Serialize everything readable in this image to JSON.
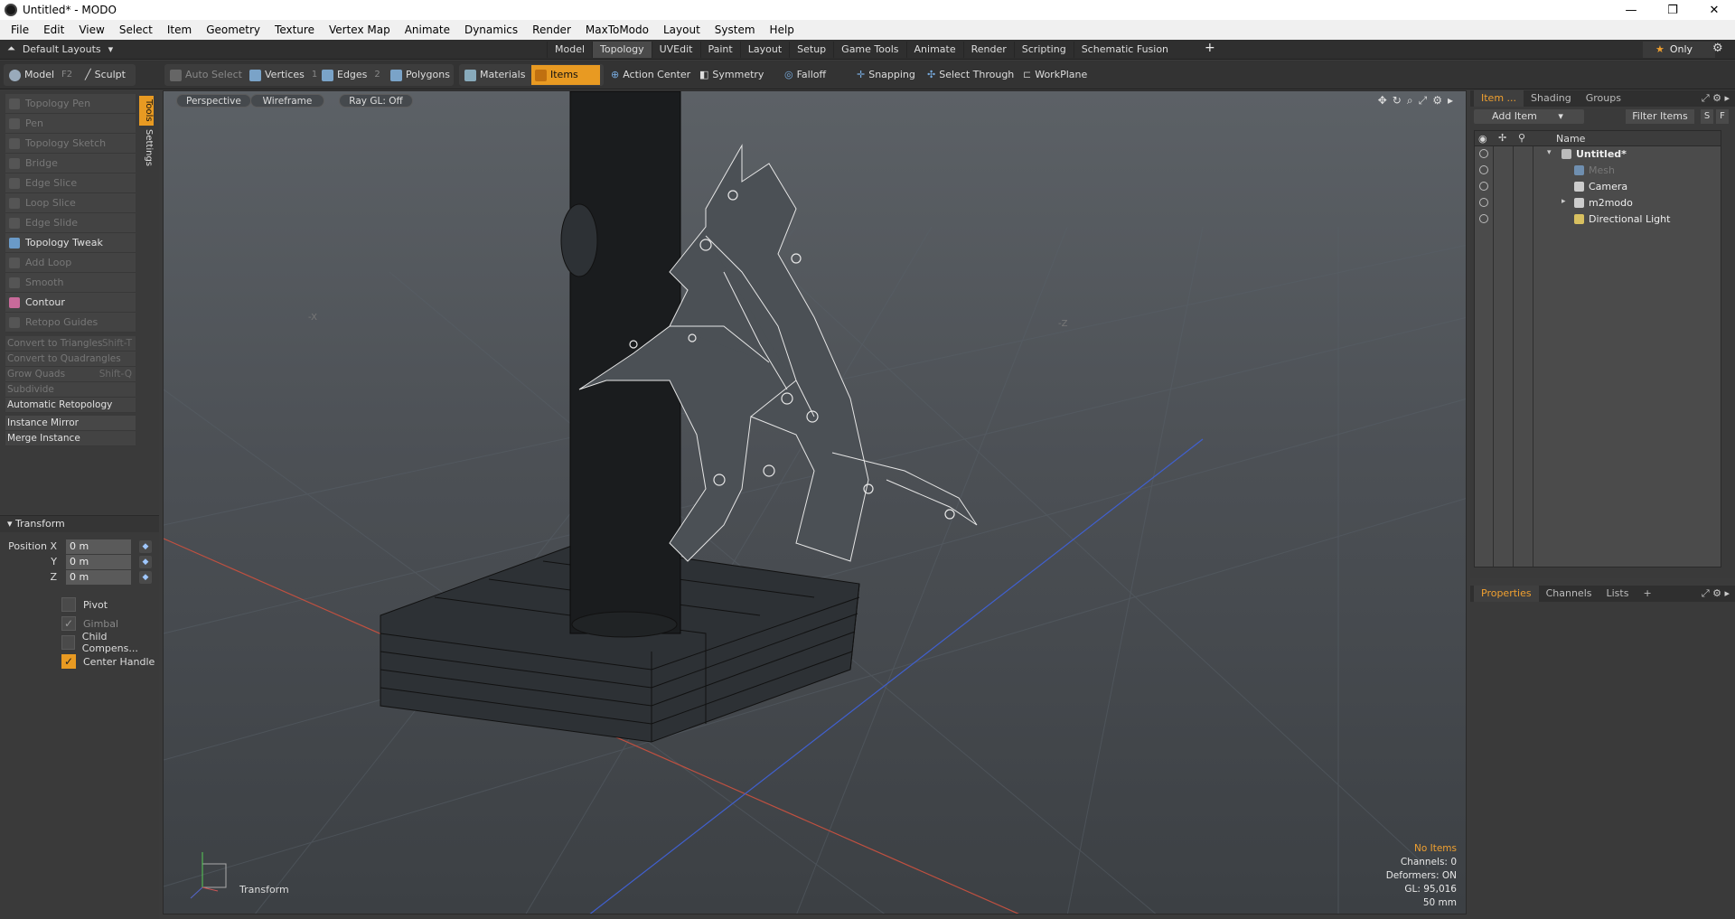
{
  "window": {
    "title": "Untitled* - MODO",
    "minimize": "—",
    "maximize": "❐",
    "close": "✕"
  },
  "menu": [
    "File",
    "Edit",
    "View",
    "Select",
    "Item",
    "Geometry",
    "Texture",
    "Vertex Map",
    "Animate",
    "Dynamics",
    "Render",
    "MaxToModo",
    "Layout",
    "System",
    "Help"
  ],
  "layout_bar": {
    "layout_selector": "Default Layouts",
    "tabs": [
      "Model",
      "Topology",
      "UVEdit",
      "Paint",
      "Layout",
      "Setup",
      "Game Tools",
      "Animate",
      "Render",
      "Scripting",
      "Schematic Fusion"
    ],
    "active_tab": "Topology",
    "add": "+",
    "only_label": "Only"
  },
  "toolbar": {
    "model": "Model",
    "model_key": "F2",
    "sculpt": "Sculpt",
    "auto_select": "Auto Select",
    "vertices": "Vertices",
    "vertices_key": "1",
    "edges": "Edges",
    "edges_key": "2",
    "polygons": "Polygons",
    "materials": "Materials",
    "items": "Items",
    "action_center": "Action Center",
    "symmetry": "Symmetry",
    "falloff": "Falloff",
    "snapping": "Snapping",
    "select_through": "Select Through",
    "workplane": "WorkPlane"
  },
  "tools": [
    {
      "label": "Topology Pen",
      "enabled": false
    },
    {
      "label": "Pen",
      "enabled": false
    },
    {
      "label": "Topology Sketch",
      "enabled": false
    },
    {
      "label": "Bridge",
      "enabled": false
    },
    {
      "label": "Edge Slice",
      "enabled": false
    },
    {
      "label": "Loop Slice",
      "enabled": false
    },
    {
      "label": "Edge Slide",
      "enabled": false
    },
    {
      "label": "Topology Tweak",
      "enabled": true
    },
    {
      "label": "Add Loop",
      "enabled": false
    },
    {
      "label": "Smooth",
      "enabled": false
    },
    {
      "label": "Contour",
      "enabled": true
    },
    {
      "label": "Retopo Guides",
      "enabled": false
    }
  ],
  "commands": {
    "convert_tri": "Convert to Triangles",
    "convert_tri_key": "Shift-T",
    "convert_quad": "Convert to Quadrangles",
    "grow_quads": "Grow Quads",
    "grow_quads_key": "Shift-Q",
    "subdivide": "Subdivide",
    "auto_retopo": "Automatic Retopology",
    "instance_mirror": "Instance Mirror",
    "merge_instance": "Merge Instance"
  },
  "side_tabs": [
    "Tools",
    "Settings"
  ],
  "transform": {
    "header": "Transform",
    "position_x_label": "Position X",
    "y_label": "Y",
    "z_label": "Z",
    "x": "0 m",
    "y": "0 m",
    "z": "0 m",
    "pivot": "Pivot",
    "gimbal": "Gimbal",
    "child_comp": "Child Compens...",
    "center_handle": "Center Handle"
  },
  "viewport": {
    "view": "Perspective",
    "shading": "Wireframe",
    "raygl": "Ray GL: Off",
    "axis_neg_x": "-X",
    "axis_neg_z": "-Z",
    "transform_label": "Transform",
    "info": {
      "items": "No Items",
      "channels": "Channels: 0",
      "deformers": "Deformers: ON",
      "gl": "GL: 95,016",
      "lens": "50 mm"
    }
  },
  "item_panel": {
    "tabs": [
      "Item ...",
      "Shading",
      "Groups"
    ],
    "add_item": "Add Item",
    "filter": "Filter Items",
    "s": "S",
    "f": "F",
    "name_col": "Name",
    "tree": [
      {
        "name": "Untitled*",
        "bold": true,
        "dim": false
      },
      {
        "name": "Mesh",
        "bold": false,
        "dim": true
      },
      {
        "name": "Camera",
        "bold": false,
        "dim": false
      },
      {
        "name": "m2modo",
        "bold": false,
        "dim": false
      },
      {
        "name": "Directional Light",
        "bold": false,
        "dim": false
      }
    ]
  },
  "prop_panel": {
    "tabs": [
      "Properties",
      "Channels",
      "Lists"
    ],
    "add": "+"
  },
  "colors": {
    "accent": "#e89a22",
    "viewport_top": "#5c6166",
    "viewport_bottom": "#3c4044"
  }
}
